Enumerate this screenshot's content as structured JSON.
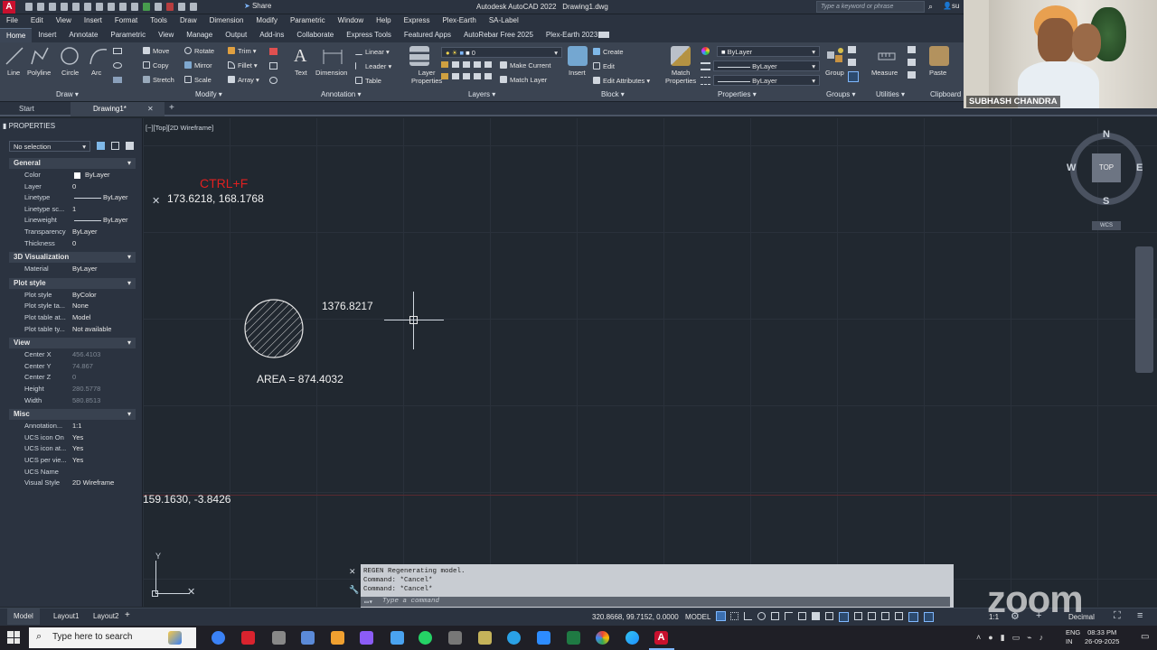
{
  "app": {
    "logo": "A",
    "title": "Autodesk AutoCAD 2022",
    "filename": "Drawing1.dwg",
    "share_label": "Share",
    "search_placeholder": "Type a keyword or phrase",
    "user_partial": "su"
  },
  "menubar": [
    "File",
    "Edit",
    "View",
    "Insert",
    "Format",
    "Tools",
    "Draw",
    "Dimension",
    "Modify",
    "Parametric",
    "Window",
    "Help",
    "Express",
    "Plex-Earth",
    "SA-Label"
  ],
  "ribbon_tabs": [
    "Home",
    "Insert",
    "Annotate",
    "Parametric",
    "View",
    "Manage",
    "Output",
    "Add-ins",
    "Collaborate",
    "Express Tools",
    "Featured Apps",
    "AutoRebar Free 2025",
    "Plex-Earth 2023"
  ],
  "ribbon": {
    "draw": {
      "line": "Line",
      "polyline": "Polyline",
      "circle": "Circle",
      "arc": "Arc",
      "panel": "Draw"
    },
    "modify": {
      "move": "Move",
      "rotate": "Rotate",
      "trim": "Trim",
      "copy": "Copy",
      "mirror": "Mirror",
      "fillet": "Fillet",
      "stretch": "Stretch",
      "scale": "Scale",
      "array": "Array",
      "panel": "Modify"
    },
    "annotation": {
      "text": "Text",
      "dimension": "Dimension",
      "linear": "Linear",
      "leader": "Leader",
      "table": "Table",
      "panel": "Annotation"
    },
    "layers": {
      "layer_properties_1": "Layer",
      "layer_properties_2": "Properties",
      "current_layer": "0",
      "make_current": "Make Current",
      "match_layer": "Match Layer",
      "panel": "Layers"
    },
    "block": {
      "insert": "Insert",
      "create": "Create",
      "edit": "Edit",
      "edit_attributes": "Edit Attributes",
      "panel": "Block"
    },
    "properties": {
      "match_1": "Match",
      "match_2": "Properties",
      "color": "ByLayer",
      "linetype": "ByLayer",
      "lineweight": "ByLayer",
      "panel": "Properties"
    },
    "groups": {
      "group": "Group",
      "panel": "Groups"
    },
    "utilities": {
      "measure": "Measure",
      "panel": "Utilities"
    },
    "clipboard": {
      "paste": "Paste",
      "panel": "Clipboard"
    }
  },
  "doc_tabs": {
    "start": "Start",
    "active": "Drawing1*",
    "add": "+"
  },
  "properties_panel": {
    "title": "PROPERTIES",
    "selection": "No selection",
    "sections": {
      "general": "General",
      "viz3d": "3D Visualization",
      "plotstyle": "Plot style",
      "view": "View",
      "misc": "Misc"
    },
    "general": [
      {
        "k": "Color",
        "v": "ByLayer"
      },
      {
        "k": "Layer",
        "v": "0"
      },
      {
        "k": "Linetype",
        "v": "ByLayer"
      },
      {
        "k": "Linetype sc...",
        "v": "1"
      },
      {
        "k": "Lineweight",
        "v": "ByLayer"
      },
      {
        "k": "Transparency",
        "v": "ByLayer"
      },
      {
        "k": "Thickness",
        "v": "0"
      }
    ],
    "viz3d": [
      {
        "k": "Material",
        "v": "ByLayer"
      }
    ],
    "plotstyle": [
      {
        "k": "Plot style",
        "v": "ByColor"
      },
      {
        "k": "Plot style ta...",
        "v": "None"
      },
      {
        "k": "Plot table at...",
        "v": "Model"
      },
      {
        "k": "Plot table ty...",
        "v": "Not available"
      }
    ],
    "view": [
      {
        "k": "Center X",
        "v": "456.4103"
      },
      {
        "k": "Center Y",
        "v": "74.867"
      },
      {
        "k": "Center Z",
        "v": "0"
      },
      {
        "k": "Height",
        "v": "280.5778"
      },
      {
        "k": "Width",
        "v": "580.8513"
      }
    ],
    "misc": [
      {
        "k": "Annotation...",
        "v": "1:1"
      },
      {
        "k": "UCS icon On",
        "v": "Yes"
      },
      {
        "k": "UCS icon at...",
        "v": "Yes"
      },
      {
        "k": "UCS per vie...",
        "v": "Yes"
      },
      {
        "k": "UCS Name",
        "v": ""
      },
      {
        "k": "Visual Style",
        "v": "2D Wireframe"
      }
    ]
  },
  "viewport": {
    "label": "[−][Top][2D Wireframe]",
    "shortcut_text": "CTRL+F",
    "coord_top": "173.6218, 168.1768",
    "dimension_value": "1376.8217",
    "area_text": "AREA = 874.4032",
    "coord_bottom": "159.1630, -3.8426",
    "viewcube": {
      "n": "N",
      "s": "S",
      "e": "E",
      "w": "W",
      "top": "TOP",
      "ucs": "WCS"
    },
    "ucs_y": "Y"
  },
  "command": {
    "history": [
      "REGEN Regenerating model.",
      "Command: *Cancel*",
      "Command: *Cancel*"
    ],
    "placeholder": "Type a command"
  },
  "statusbar": {
    "coords": "320.8668, 99.7152, 0.0000",
    "mode": "MODEL",
    "scale": "1:1",
    "units": "Decimal",
    "layout_tabs": [
      "Model",
      "Layout1",
      "Layout2"
    ],
    "add": "+"
  },
  "taskbar": {
    "search_placeholder": "Type here to search",
    "lang_1": "ENG",
    "lang_2": "IN",
    "time": "08:33 PM",
    "date": "26-09-2025"
  },
  "webcam": {
    "name": "SUBHASH CHANDRA",
    "watermark": "zoom"
  },
  "colors": {
    "accent_red": "#e02020",
    "canvas": "#212830",
    "panel": "#2b3340"
  }
}
